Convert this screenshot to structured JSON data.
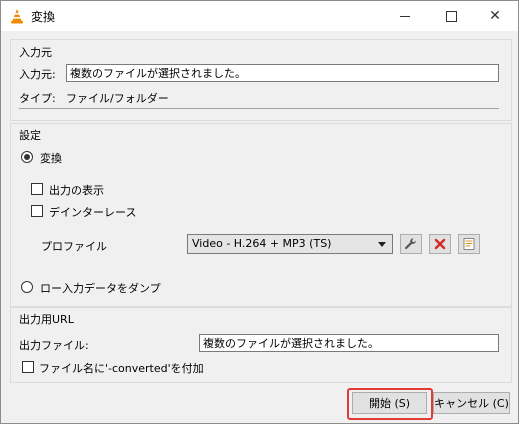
{
  "window": {
    "title": "変換"
  },
  "source": {
    "group_title": "入力元",
    "source_label": "入力元:",
    "source_value": "複数のファイルが選択されました。",
    "type_label": "タイプ:",
    "type_value": "ファイル/フォルダー"
  },
  "settings": {
    "group_title": "設定",
    "convert_label": "変換",
    "convert_selected": true,
    "show_output_label": "出力の表示",
    "deinterlace_label": "デインターレース",
    "profile_label": "プロファイル",
    "profile_selected": "Video - H.264 + MP3 (TS)",
    "dump_raw_label": "ロー入力データをダンプ"
  },
  "destination": {
    "group_title": "出力用URL",
    "file_label": "出力ファイル:",
    "file_value": "複数のファイルが選択されました。",
    "append_label": "ファイル名に'-converted'を付加"
  },
  "buttons": {
    "start_label": "開始 (S)",
    "cancel_label": "キャンセル (C)"
  },
  "colors": {
    "highlight": "#e53935",
    "delete_icon": "#d62828",
    "vlc_orange": "#f08a00"
  }
}
